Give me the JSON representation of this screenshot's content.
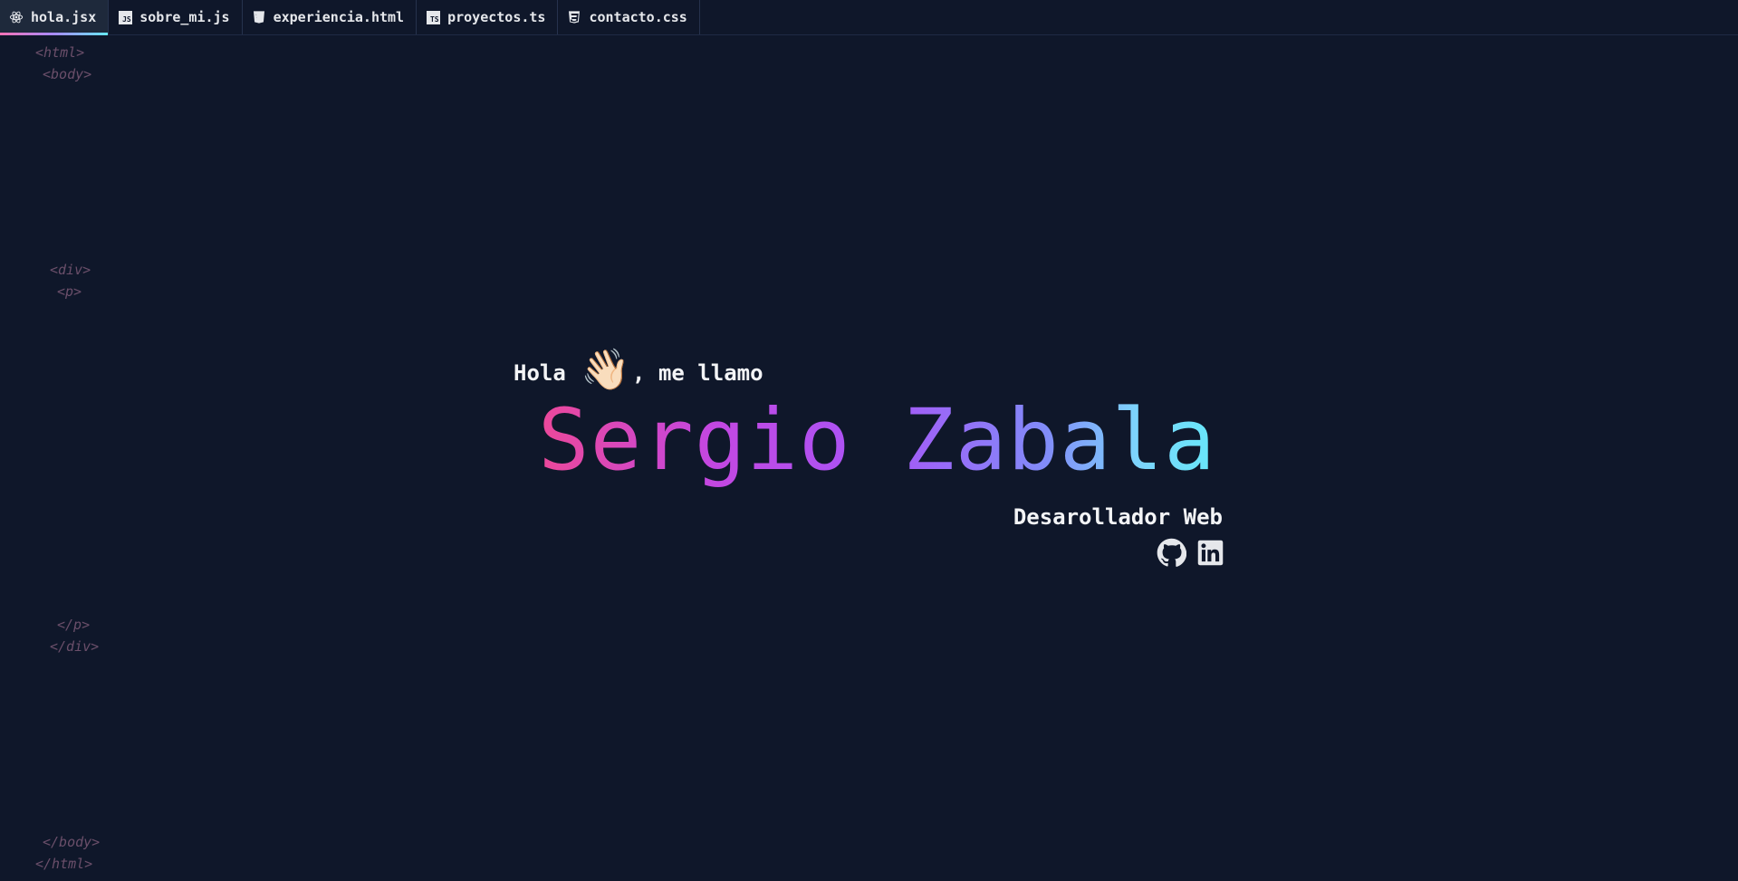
{
  "tabs": [
    {
      "label": "hola.jsx",
      "icon": "react-icon",
      "active": true
    },
    {
      "label": "sobre_mi.js",
      "icon": "js-icon",
      "active": false
    },
    {
      "label": "experiencia.html",
      "icon": "html5-icon",
      "active": false
    },
    {
      "label": "proyectos.ts",
      "icon": "ts-icon",
      "active": false
    },
    {
      "label": "contacto.css",
      "icon": "css3-icon",
      "active": false
    }
  ],
  "icon_text": {
    "js": "JS",
    "ts": "TS"
  },
  "code_tags": {
    "html_open": "<html>",
    "body_open": "<body>",
    "div_open": "<div>",
    "p_open": "<p>",
    "p_close": "</p>",
    "div_close": "</div>",
    "body_close": "</body>",
    "html_close": "</html>"
  },
  "hero": {
    "greeting_before": "Hola ",
    "wave_emoji": "👋🏻",
    "greeting_after": ", me llamo",
    "name": "Sergio Zabala",
    "role": "Desarollador Web"
  },
  "socials": [
    {
      "icon": "github-icon"
    },
    {
      "icon": "linkedin-icon"
    }
  ],
  "colors": {
    "background": "#0f172a",
    "gradient_start": "#ec4899",
    "gradient_mid": "#a855f7",
    "gradient_end": "#67e8f9",
    "tag_color": "#6b4f6a"
  }
}
